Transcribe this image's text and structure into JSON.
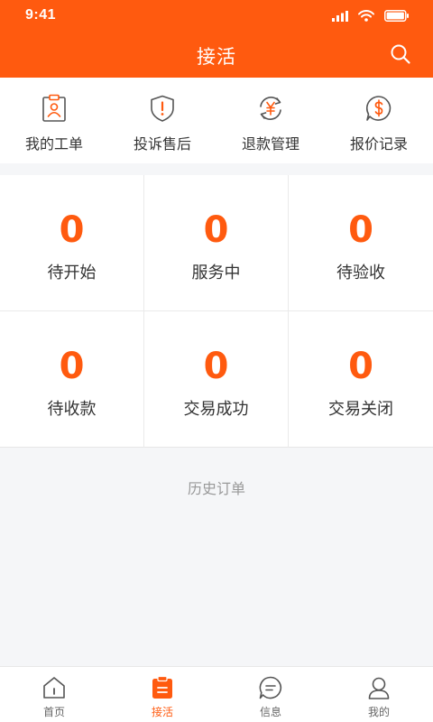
{
  "status_bar": {
    "time": "9:41"
  },
  "header": {
    "title": "接活"
  },
  "quick_actions": [
    {
      "label": "我的工单",
      "icon": "clipboard-user-icon"
    },
    {
      "label": "投诉售后",
      "icon": "shield-alert-icon"
    },
    {
      "label": "退款管理",
      "icon": "refund-yen-icon"
    },
    {
      "label": "报价记录",
      "icon": "dollar-bubble-icon"
    }
  ],
  "stats": [
    {
      "value": "0",
      "label": "待开始"
    },
    {
      "value": "0",
      "label": "服务中"
    },
    {
      "value": "0",
      "label": "待验收"
    },
    {
      "value": "0",
      "label": "待收款"
    },
    {
      "value": "0",
      "label": "交易成功"
    },
    {
      "value": "0",
      "label": "交易关闭"
    }
  ],
  "history_label": "历史订单",
  "tabs": [
    {
      "label": "首页",
      "icon": "home-icon",
      "active": false
    },
    {
      "label": "接活",
      "icon": "clipboard-icon",
      "active": true
    },
    {
      "label": "信息",
      "icon": "message-icon",
      "active": false
    },
    {
      "label": "我的",
      "icon": "user-icon",
      "active": false
    }
  ],
  "colors": {
    "accent": "#ff5a0f",
    "text": "#333333",
    "muted": "#999999",
    "background": "#f5f6f8"
  }
}
